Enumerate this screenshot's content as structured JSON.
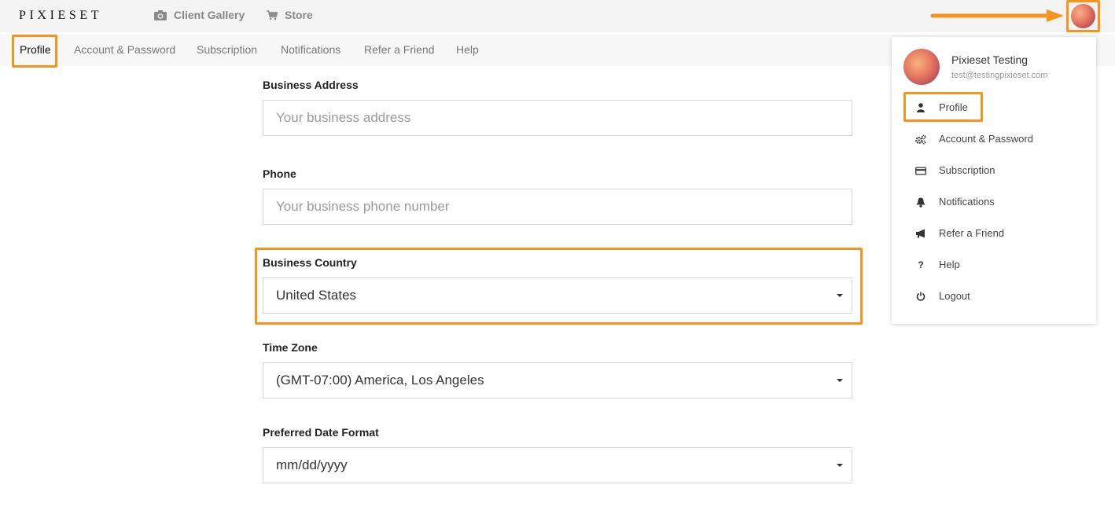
{
  "header": {
    "logo": "PIXIESET",
    "nav": [
      {
        "label": "Client Gallery",
        "icon": "camera-icon"
      },
      {
        "label": "Store",
        "icon": "cart-icon"
      }
    ]
  },
  "subnav": {
    "tabs": [
      {
        "label": "Profile",
        "active": true
      },
      {
        "label": "Account & Password"
      },
      {
        "label": "Subscription"
      },
      {
        "label": "Notifications"
      },
      {
        "label": "Refer a Friend"
      },
      {
        "label": "Help"
      }
    ]
  },
  "form": {
    "business_address": {
      "label": "Business Address",
      "placeholder": "Your business address",
      "value": ""
    },
    "phone": {
      "label": "Phone",
      "placeholder": "Your business phone number",
      "value": ""
    },
    "business_country": {
      "label": "Business Country",
      "value": "United States"
    },
    "time_zone": {
      "label": "Time Zone",
      "value": "(GMT-07:00) America, Los Angeles"
    },
    "date_format": {
      "label": "Preferred Date Format",
      "value": "mm/dd/yyyy"
    }
  },
  "dropdown": {
    "user_name": "Pixieset Testing",
    "user_email": "test@testingpixieset.com",
    "items": [
      {
        "label": "Profile",
        "icon": "user-icon"
      },
      {
        "label": "Account & Password",
        "icon": "gears-icon"
      },
      {
        "label": "Subscription",
        "icon": "credit-card-icon"
      },
      {
        "label": "Notifications",
        "icon": "bell-icon"
      },
      {
        "label": "Refer a Friend",
        "icon": "megaphone-icon"
      },
      {
        "label": "Help",
        "icon": "question-icon"
      },
      {
        "label": "Logout",
        "icon": "power-icon"
      }
    ]
  },
  "colors": {
    "highlight": "#f7941d",
    "topbar_bg": "#f4f3f3",
    "subnav_bg": "#f7f7f7"
  }
}
